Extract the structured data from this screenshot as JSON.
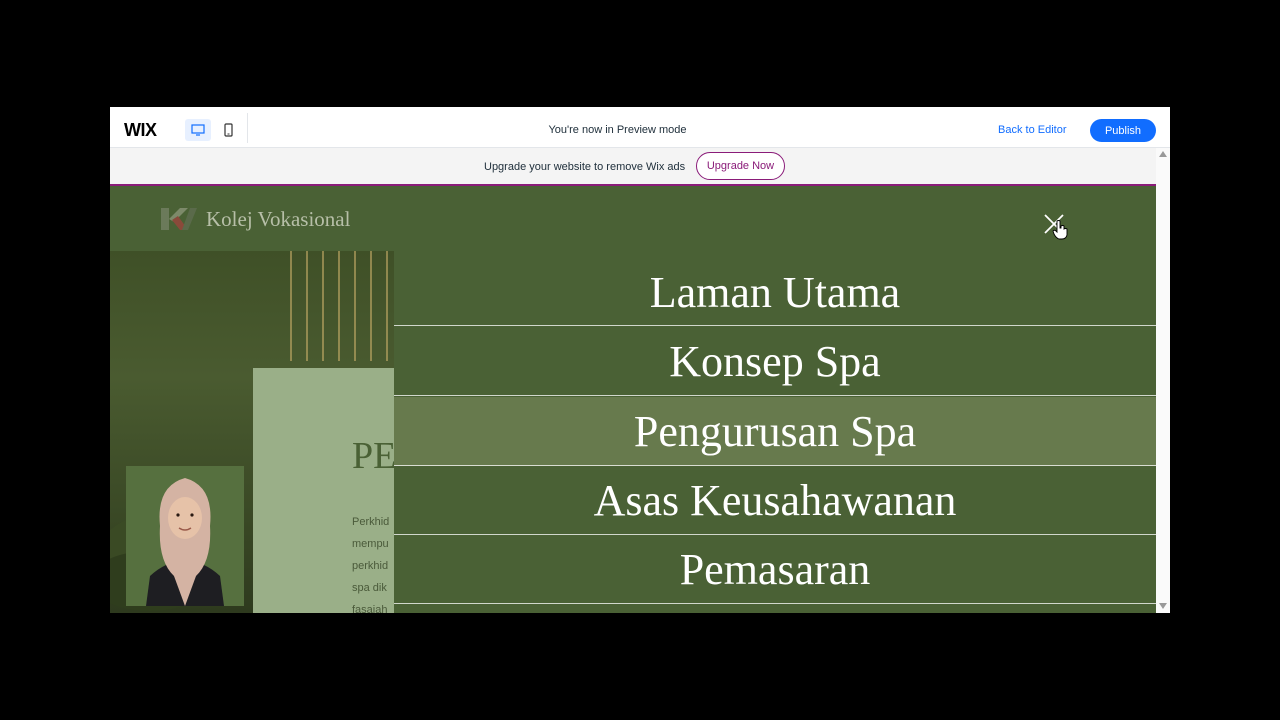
{
  "editor": {
    "logo": "WIX",
    "preview_message": "You're now in Preview mode",
    "back_to_editor": "Back to Editor",
    "publish": "Publish",
    "accent_color": "#116dff"
  },
  "ads_banner": {
    "message": "Upgrade your website to remove Wix ads",
    "upgrade_button": "Upgrade Now",
    "accent_color": "#8a1b79"
  },
  "site": {
    "logo_text": "Kolej Vokasional",
    "background_color": "#4a6135",
    "hero_heading": "PE",
    "hero_lines": [
      "Perkhid",
      "mempu",
      "perkhid",
      "spa dik",
      "fasaiah"
    ]
  },
  "menu": {
    "items": [
      {
        "label": "Laman Utama",
        "active": false
      },
      {
        "label": "Konsep Spa",
        "active": false
      },
      {
        "label": "Pengurusan Spa",
        "active": true
      },
      {
        "label": "Asas Keusahawanan",
        "active": false
      },
      {
        "label": "Pemasaran",
        "active": false
      }
    ],
    "active_color": "#677a4d"
  }
}
